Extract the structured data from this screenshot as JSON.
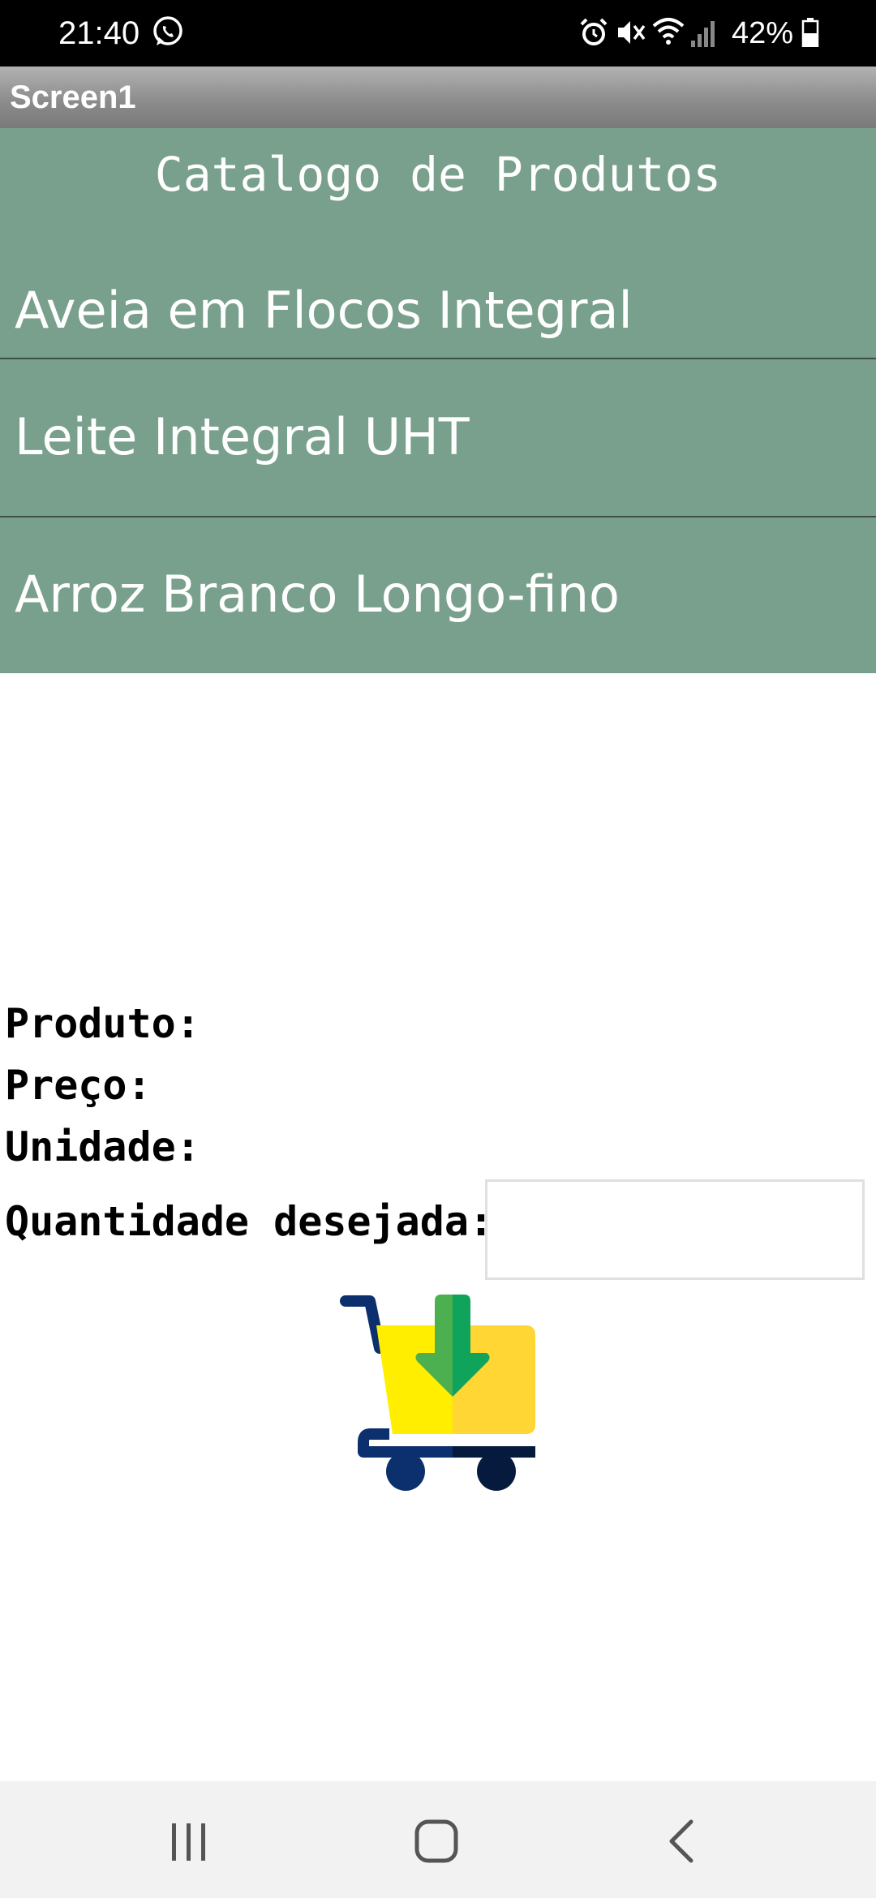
{
  "status_bar": {
    "time": "21:40",
    "battery": "42%",
    "icons": [
      "whatsapp-icon",
      "alarm-icon",
      "mute-icon",
      "wifi-icon",
      "signal-icon",
      "battery-icon"
    ]
  },
  "app": {
    "screen_title": "Screen1"
  },
  "catalog": {
    "title": "Catalogo de Produtos",
    "items": [
      {
        "label": "Aveia em Flocos Integral"
      },
      {
        "label": "Leite Integral UHT"
      },
      {
        "label": "Arroz Branco Longo-fino"
      }
    ],
    "background_color": "#78a08c"
  },
  "details": {
    "product_label": "Produto:",
    "price_label": "Preço:",
    "unit_label": "Unidade:",
    "quantity_label": "Quantidade desejada:",
    "quantity_value": "",
    "cart_button_icon": "add-to-cart-icon"
  },
  "nav_bar": {
    "icons": [
      "recent-apps-icon",
      "home-icon",
      "back-icon"
    ]
  }
}
